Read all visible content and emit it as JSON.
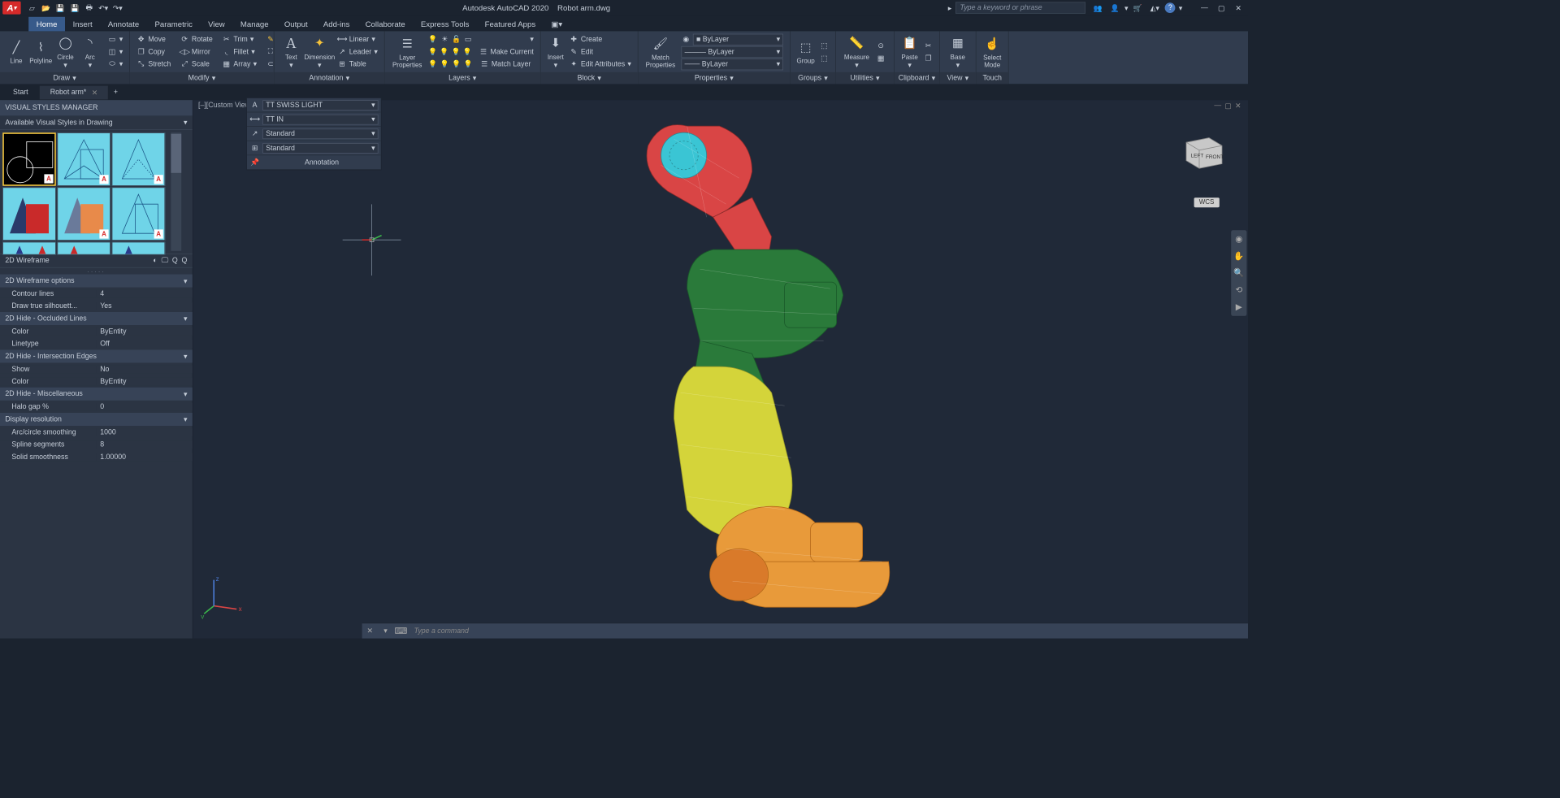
{
  "qat": {
    "title_app": "Autodesk AutoCAD 2020",
    "title_file": "Robot arm.dwg",
    "search_placeholder": "Type a keyword or phrase"
  },
  "menu_tabs": [
    "Home",
    "Insert",
    "Annotate",
    "Parametric",
    "View",
    "Manage",
    "Output",
    "Add-ins",
    "Collaborate",
    "Express Tools",
    "Featured Apps"
  ],
  "ribbon": {
    "draw": {
      "title": "Draw",
      "line": "Line",
      "polyline": "Polyline",
      "circle": "Circle",
      "arc": "Arc"
    },
    "modify": {
      "title": "Modify",
      "move": "Move",
      "copy": "Copy",
      "stretch": "Stretch",
      "rotate": "Rotate",
      "mirror": "Mirror",
      "scale": "Scale",
      "trim": "Trim",
      "fillet": "Fillet",
      "array": "Array"
    },
    "annotation": {
      "title": "Annotation",
      "text": "Text",
      "dimension": "Dimension",
      "linear": "Linear",
      "leader": "Leader",
      "table": "Table"
    },
    "layers": {
      "title": "Layers",
      "layer_props": "Layer\nProperties",
      "make_current": "Make Current",
      "match_layer": "Match Layer"
    },
    "block": {
      "title": "Block",
      "insert": "Insert",
      "create": "Create",
      "edit": "Edit",
      "edit_attributes": "Edit Attributes"
    },
    "properties": {
      "title": "Properties",
      "match": "Match\nProperties",
      "bylayer": "ByLayer"
    },
    "groups": {
      "title": "Groups",
      "group": "Group"
    },
    "utilities": {
      "title": "Utilities",
      "measure": "Measure"
    },
    "clipboard": {
      "title": "Clipboard",
      "paste": "Paste"
    },
    "view": {
      "title": "View",
      "base": "Base"
    },
    "touch": {
      "title": "Touch",
      "select": "Select\nMode"
    }
  },
  "annot_panel": {
    "font": "TT SWISS LIGHT",
    "dim": "TT IN",
    "std1": "Standard",
    "std2": "Standard",
    "title": "Annotation"
  },
  "doc_tabs": {
    "start": "Start",
    "file": "Robot arm*"
  },
  "vsm": {
    "title": "VISUAL STYLES MANAGER",
    "avail": "Available Visual Styles in Drawing",
    "current_name": "2D Wireframe",
    "sections": [
      {
        "title": "2D Wireframe options",
        "rows": [
          [
            "Contour lines",
            "4"
          ],
          [
            "Draw true silhouett...",
            "Yes"
          ]
        ]
      },
      {
        "title": "2D Hide - Occluded Lines",
        "rows": [
          [
            "Color",
            "ByEntity"
          ],
          [
            "Linetype",
            "Off"
          ]
        ]
      },
      {
        "title": "2D Hide - Intersection Edges",
        "rows": [
          [
            "Show",
            "No"
          ],
          [
            "Color",
            "ByEntity"
          ]
        ]
      },
      {
        "title": "2D Hide - Miscellaneous",
        "rows": [
          [
            "Halo gap %",
            "0"
          ]
        ]
      },
      {
        "title": "Display resolution",
        "rows": [
          [
            "Arc/circle smoothing",
            "1000"
          ],
          [
            "Spline segments",
            "8"
          ],
          [
            "Solid smoothness",
            "1.00000"
          ]
        ]
      }
    ]
  },
  "viewport": {
    "label": "[–][Custom View",
    "wcs": "WCS",
    "cube_left": "LEFT",
    "cube_front": "FRONT"
  },
  "cmdline": {
    "prompt": "Type a command"
  }
}
